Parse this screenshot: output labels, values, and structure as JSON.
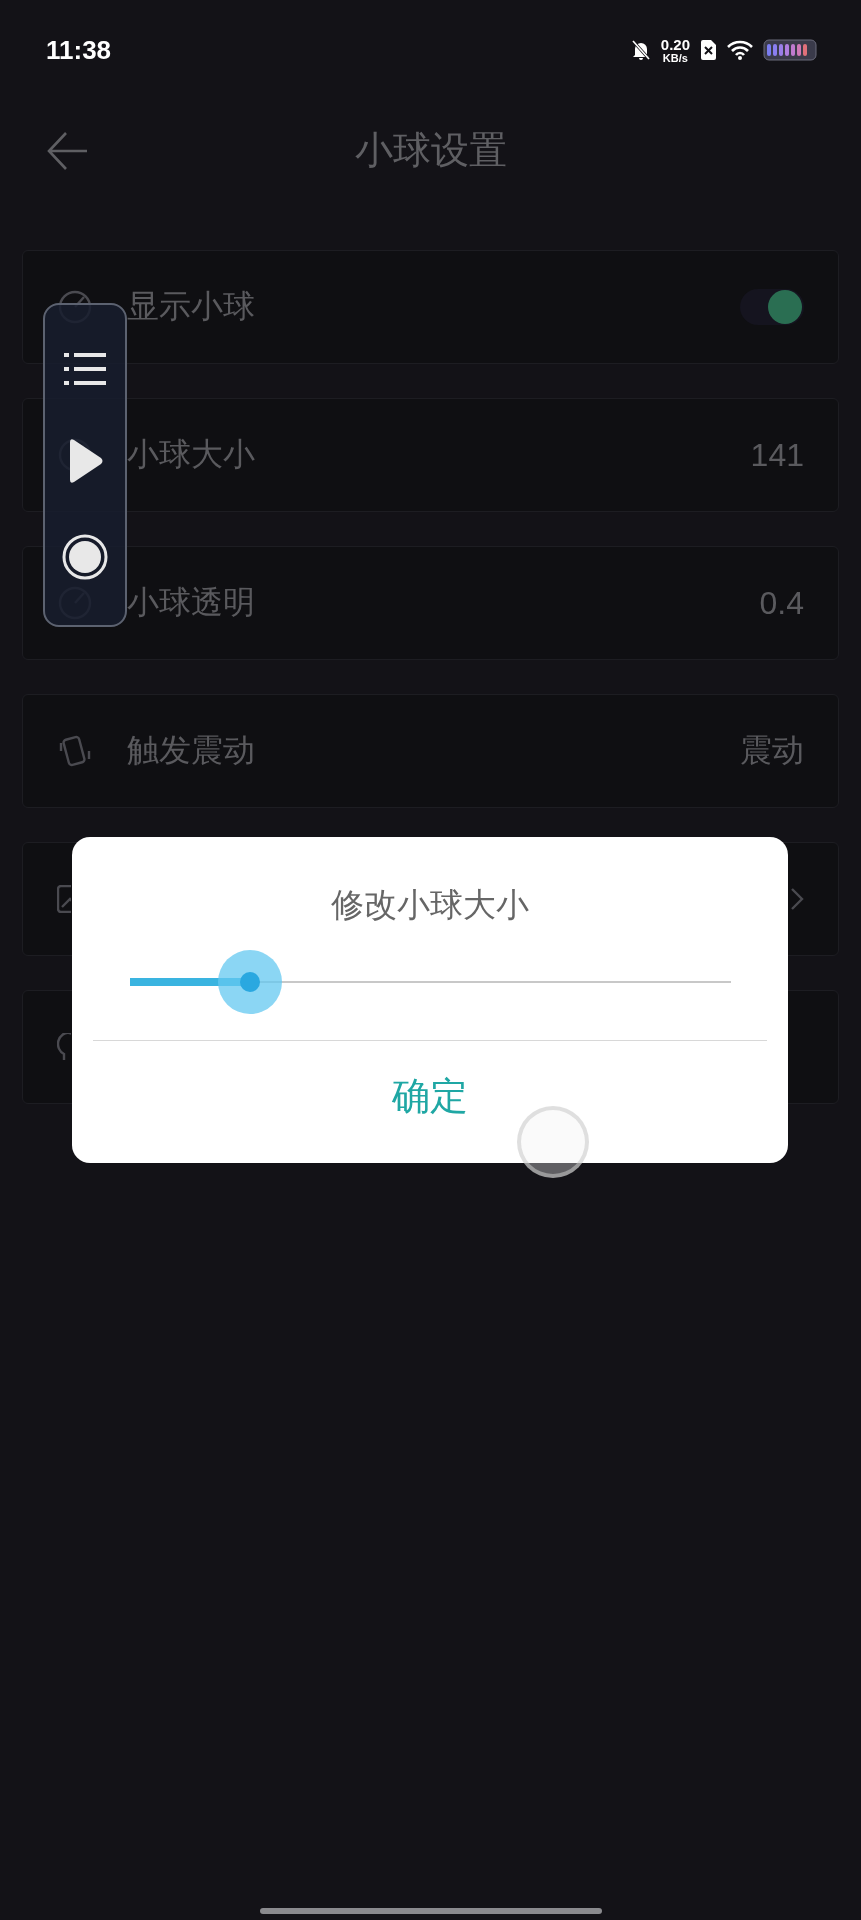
{
  "status_bar": {
    "time": "11:38",
    "net_speed": "0.20",
    "net_unit": "KB/s"
  },
  "header": {
    "title": "小球设置"
  },
  "groups": [
    {
      "rows": [
        {
          "kind": "toggle",
          "label": "显示小球",
          "on": true
        },
        {
          "kind": "value",
          "label": "小球大小",
          "value": "141"
        },
        {
          "kind": "value",
          "label": "小球透明",
          "value": "0.4"
        }
      ]
    },
    {
      "rows": [
        {
          "kind": "value",
          "label": "触发震动",
          "value": "震动"
        }
      ]
    },
    {
      "rows": [
        {
          "kind": "link"
        }
      ]
    },
    {
      "rows": [
        {
          "kind": "plain"
        }
      ]
    }
  ],
  "dialog": {
    "title": "修改小球大小",
    "slider": {
      "level": 0.2
    },
    "button": "确定"
  }
}
